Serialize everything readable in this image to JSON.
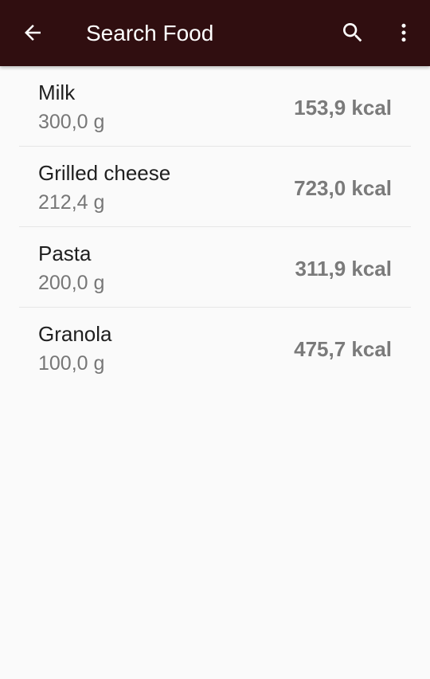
{
  "toolbar": {
    "title": "Search Food",
    "back_icon": "arrow-left-icon",
    "search_icon": "search-icon",
    "more_icon": "more-vertical-icon",
    "background_color": "#300e10"
  },
  "foods": [
    {
      "name": "Milk",
      "weight": "300,0 g",
      "kcal": "153,9 kcal"
    },
    {
      "name": "Grilled cheese",
      "weight": "212,4 g",
      "kcal": "723,0 kcal"
    },
    {
      "name": "Pasta",
      "weight": "200,0 g",
      "kcal": "311,9 kcal"
    },
    {
      "name": "Granola",
      "weight": "100,0 g",
      "kcal": "475,7 kcal"
    }
  ]
}
